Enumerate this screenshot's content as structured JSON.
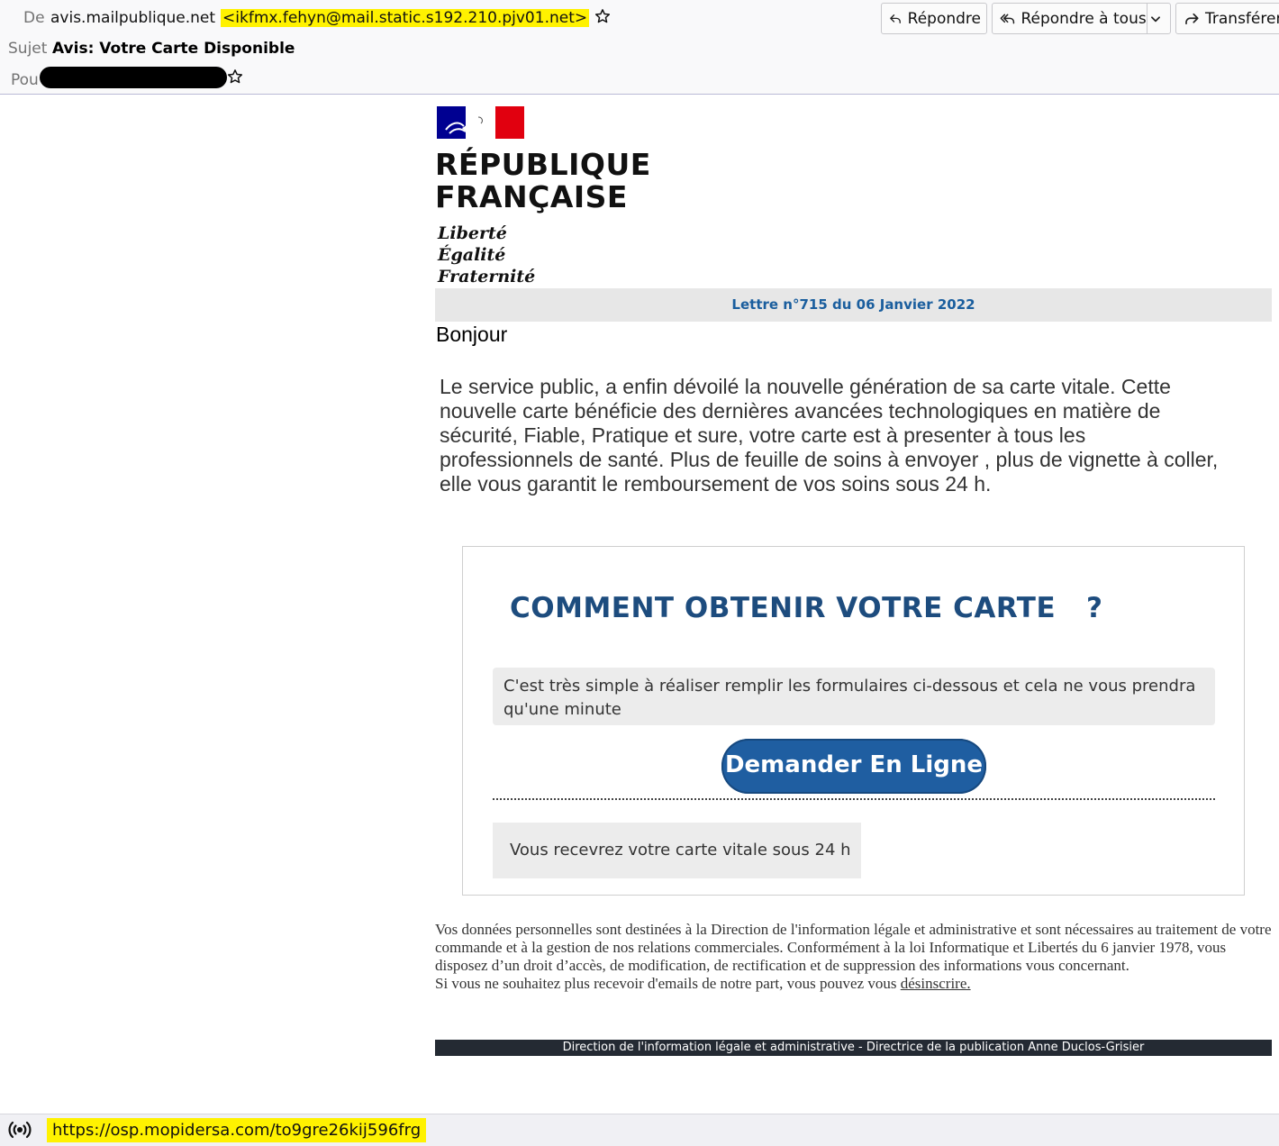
{
  "header": {
    "from_label": "De",
    "from_name": "avis.mailpublique.net",
    "from_email": "<ikfmx.fehyn@mail.static.s192.210.pjv01.net>",
    "subject_label": "Sujet",
    "subject": "Avis: Votre Carte Disponible",
    "to_label": "Pou",
    "buttons": {
      "reply": "Répondre",
      "reply_all": "Répondre à tous",
      "forward": "Transférer"
    }
  },
  "message": {
    "logo": {
      "line1": "RÉPUBLIQUE",
      "line2": "FRANÇAISE",
      "motto1": "Liberté",
      "motto2": "Égalité",
      "motto3": "Fraternité"
    },
    "letter_ref": "Lettre n°715 du 06 Janvier 2022",
    "greeting": "Bonjour",
    "intro": "Le service public, a enfin dévoilé la nouvelle génération de sa carte vitale. Cette nouvelle carte bénéficie des dernières avancées technologiques en matière de sécurité, Fiable, Pratique et sure, votre carte est à presenter à tous les professionnels de santé. Plus de feuille de soins à envoyer , plus de vignette à coller, elle vous garantit le remboursement de vos soins sous 24 h.",
    "card": {
      "title": "COMMENT OBTENIR VOTRE CARTE   ?",
      "simple": "C'est très simple à réaliser remplir les formulaires ci-dessous et cela ne vous prendra qu'une minute",
      "cta": "Demander En Ligne",
      "delivery": "Vous recevrez votre carte vitale sous 24 h"
    },
    "legal": "Vos données personnelles sont destinées à la Direction de l'information légale et administrative et sont nécessaires au traitement de votre commande et à la gestion de nos relations commerciales. Conformément à la loi Informatique et Libertés du 6 janvier 1978, vous disposez d’un droit d’accès, de modification, de rectification et de suppression des informations vous concernant.",
    "unsubscribe_text": "Si vous ne souhaitez plus recevoir d'emails de notre part, vous pouvez vous",
    "unsubscribe_link": "désinscrire.",
    "footer": "Direction de l'information légale et administrative - Directrice de la publication Anne Duclos-Grisier"
  },
  "statusbar": {
    "url": "https://osp.mopidersa.com/to9gre26kij596frg"
  },
  "colors": {
    "highlight": "#fff200",
    "letter_ref": "#1a5e9e",
    "card_title": "#1d4c7e",
    "cta_background": "#1f5ea1",
    "footer_background": "#242a33",
    "flag_blue": "#000091",
    "flag_red": "#e1000f"
  }
}
